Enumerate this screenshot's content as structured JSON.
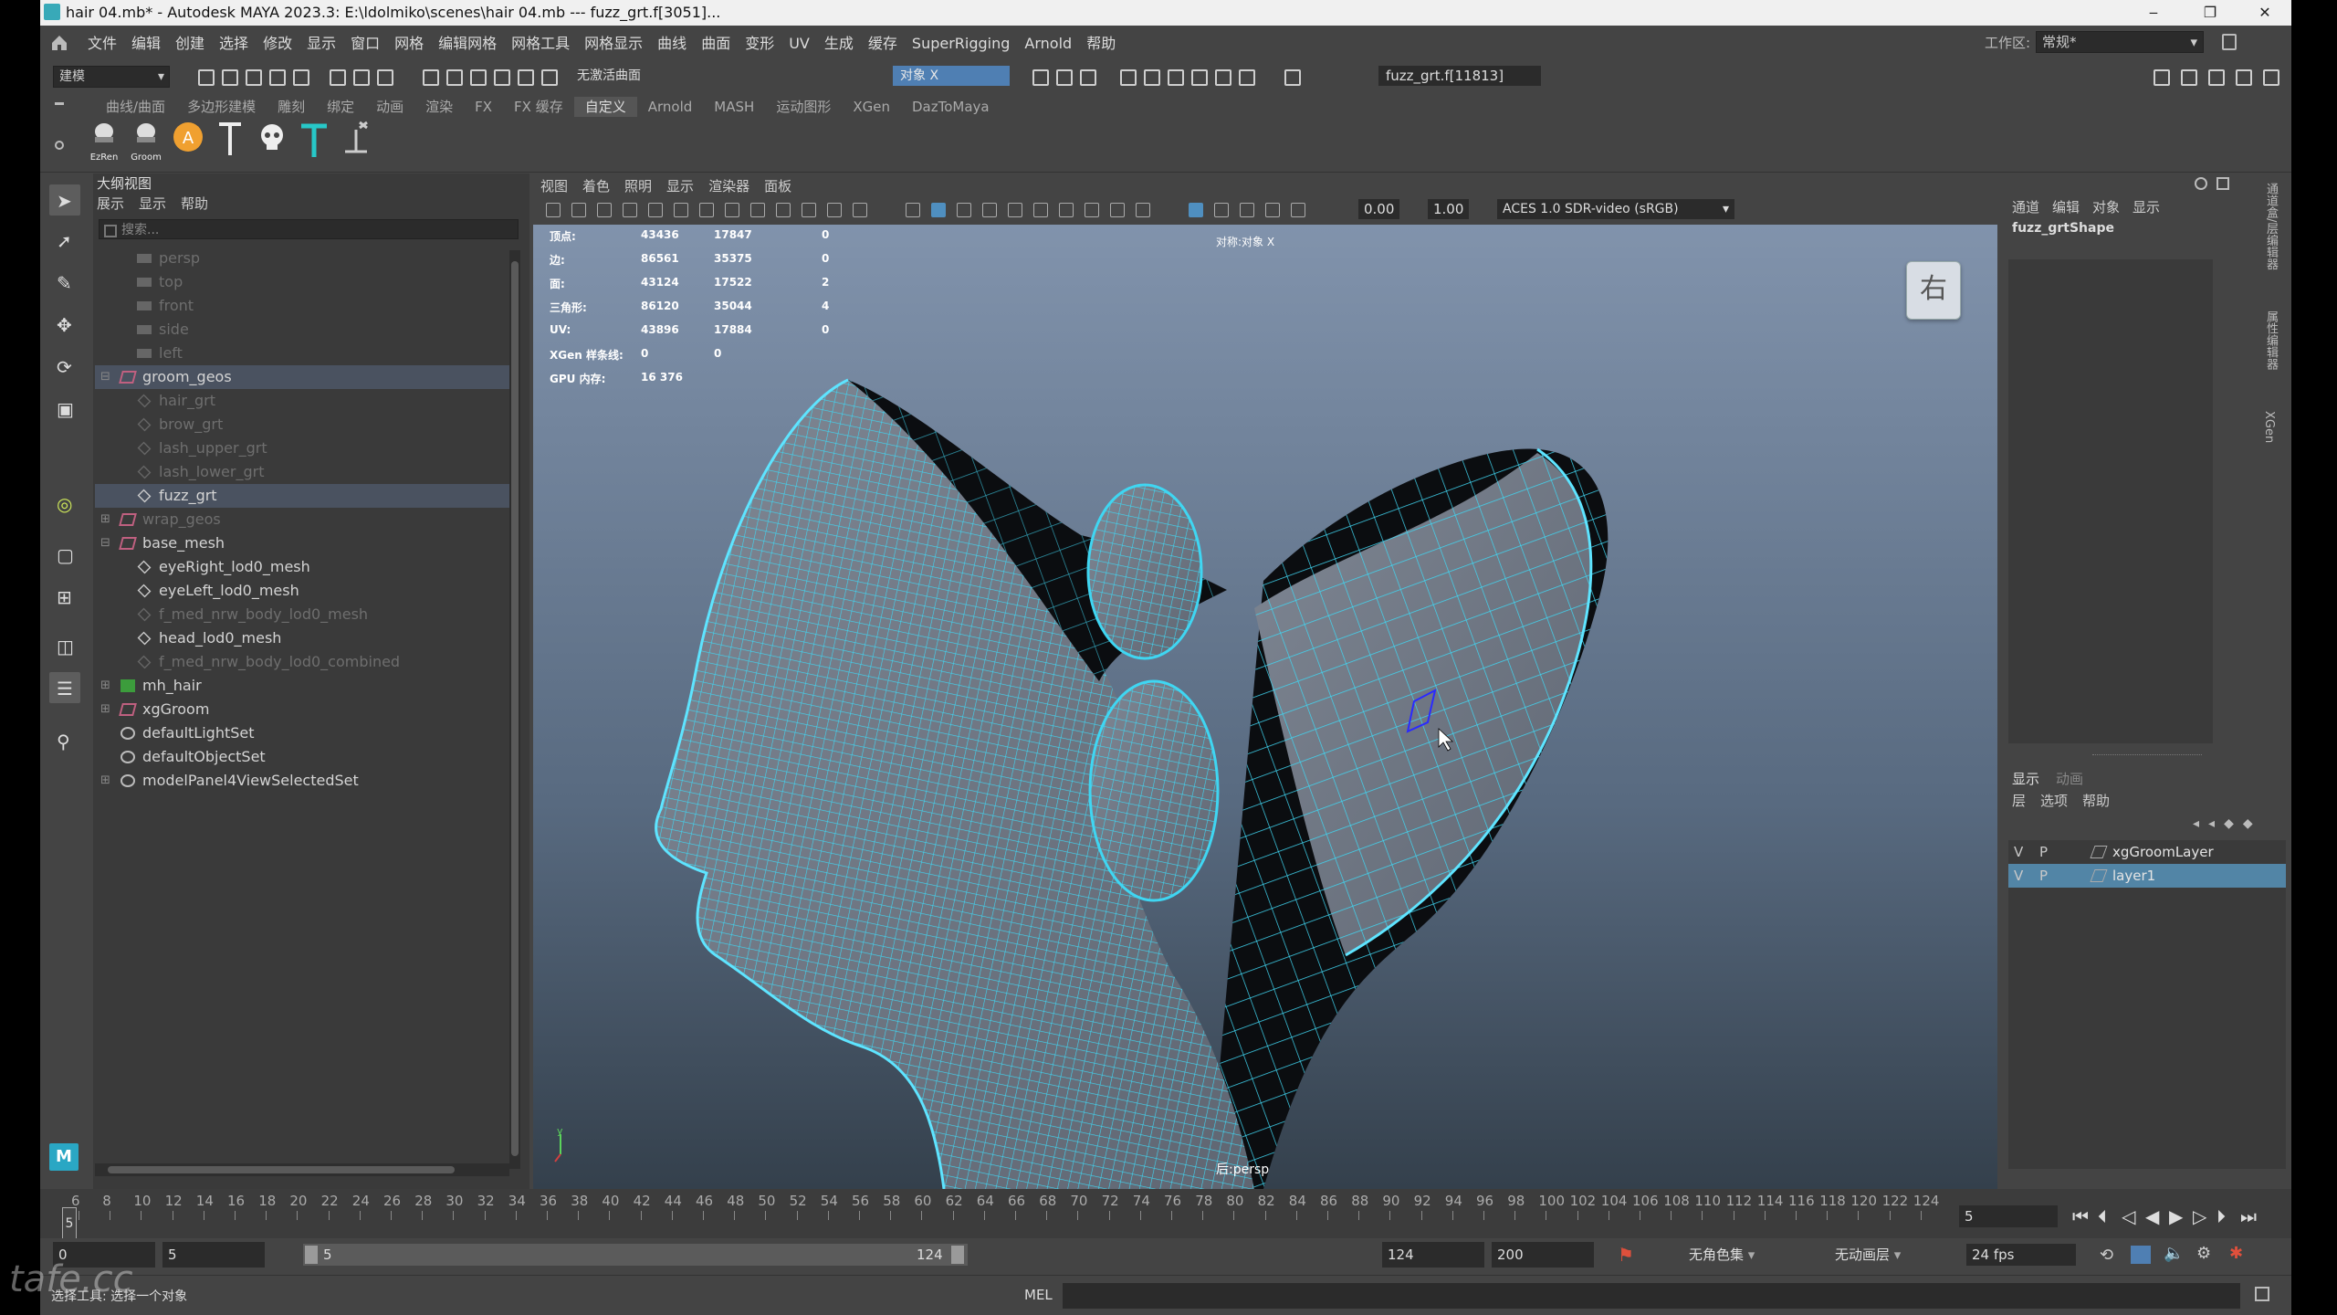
{
  "window": {
    "title": "hair 04.mb* - Autodesk MAYA 2023.3: E:\\ldolmiko\\scenes\\hair 04.mb  ---  fuzz_grt.f[3051]...",
    "minimize": "‒",
    "restore": "❐",
    "close": "✕"
  },
  "menubar": {
    "items": [
      "文件",
      "编辑",
      "创建",
      "选择",
      "修改",
      "显示",
      "窗口",
      "网格",
      "编辑网格",
      "网格工具",
      "网格显示",
      "曲线",
      "曲面",
      "变形",
      "UV",
      "生成",
      "缓存",
      "SuperRigging",
      "Arnold",
      "帮助"
    ],
    "workspace_label": "工作区:",
    "workspace_value": "常规*"
  },
  "statusline": {
    "mode": "建模",
    "live_surface": "无激活曲面",
    "symmetry": "对象 X",
    "selection_field": "fuzz_grt.f[11813]"
  },
  "shelf": {
    "tabs": [
      "曲线/曲面",
      "多边形建模",
      "雕刻",
      "绑定",
      "动画",
      "渲染",
      "FX",
      "FX 缓存",
      "自定义",
      "Arnold",
      "MASH",
      "运动图形",
      "XGen",
      "DazToMaya"
    ],
    "active_tab": "自定义",
    "buttons": [
      {
        "label": "EzRen"
      },
      {
        "label": "Groom"
      },
      {
        "label": "A"
      }
    ]
  },
  "outliner": {
    "title": "大纲视图",
    "menu": [
      "展示",
      "显示",
      "帮助"
    ],
    "search_placeholder": "搜索...",
    "rows": [
      {
        "label": "persp",
        "dim": true
      },
      {
        "label": "top",
        "dim": true
      },
      {
        "label": "front",
        "dim": true
      },
      {
        "label": "side",
        "dim": true
      },
      {
        "label": "left",
        "dim": true
      },
      {
        "label": "groom_geos",
        "dim": false
      },
      {
        "label": "hair_grt",
        "dim": true
      },
      {
        "label": "brow_grt",
        "dim": true
      },
      {
        "label": "lash_upper_grt",
        "dim": true
      },
      {
        "label": "lash_lower_grt",
        "dim": true
      },
      {
        "label": "fuzz_grt",
        "dim": false
      },
      {
        "label": "wrap_geos",
        "dim": true
      },
      {
        "label": "base_mesh",
        "dim": false
      },
      {
        "label": "eyeRight_lod0_mesh",
        "dim": false
      },
      {
        "label": "eyeLeft_lod0_mesh",
        "dim": false
      },
      {
        "label": "f_med_nrw_body_lod0_mesh",
        "dim": true
      },
      {
        "label": "head_lod0_mesh",
        "dim": false
      },
      {
        "label": "f_med_nrw_body_lod0_combined",
        "dim": true
      },
      {
        "label": "mh_hair",
        "dim": false
      },
      {
        "label": "xgGroom",
        "dim": false
      },
      {
        "label": "defaultLightSet",
        "dim": false
      },
      {
        "label": "defaultObjectSet",
        "dim": false
      },
      {
        "label": "modelPanel4ViewSelectedSet",
        "dim": false
      }
    ]
  },
  "viewport": {
    "menu": [
      "视图",
      "着色",
      "照明",
      "显示",
      "渲染器",
      "面板"
    ],
    "exposure": "0.00",
    "gamma": "1.00",
    "color_space": "ACES 1.0 SDR-video (sRGB)",
    "symmetry_hud": "对称:对象 X",
    "view_cube": "右",
    "camera_label": "后:persp",
    "hud": [
      {
        "label": "顶点:",
        "c1": "43436",
        "c2": "17847",
        "c3": "0"
      },
      {
        "label": "边:",
        "c1": "86561",
        "c2": "35375",
        "c3": "0"
      },
      {
        "label": "面:",
        "c1": "43124",
        "c2": "17522",
        "c3": "2"
      },
      {
        "label": "三角形:",
        "c1": "86120",
        "c2": "35044",
        "c3": "4"
      },
      {
        "label": "UV:",
        "c1": "43896",
        "c2": "17884",
        "c3": "0"
      },
      {
        "label": "XGen 样条线:",
        "c1": "0",
        "c2": "0",
        "c3": ""
      },
      {
        "label": "GPU 内存:",
        "c1": "16 376",
        "c2": "",
        "c3": ""
      }
    ]
  },
  "channel_box": {
    "menu": [
      "通道",
      "编辑",
      "对象",
      "显示"
    ],
    "object_name": "fuzz_grtShape",
    "side_tabs": [
      "通道盒/层编辑器",
      "属性编辑器",
      "XGen"
    ]
  },
  "layers": {
    "tabs": [
      "显示",
      "动画"
    ],
    "menu": [
      "层",
      "选项",
      "帮助"
    ],
    "rows": [
      {
        "v": "V",
        "p": "P",
        "name": "xgGroomLayer",
        "selected": false
      },
      {
        "v": "V",
        "p": "P",
        "name": "layer1",
        "selected": true
      }
    ]
  },
  "timeline": {
    "ticks": [
      "6",
      "8",
      "10",
      "12",
      "14",
      "16",
      "18",
      "20",
      "22",
      "24",
      "26",
      "28",
      "30",
      "32",
      "34",
      "36",
      "38",
      "40",
      "42",
      "44",
      "46",
      "48",
      "50",
      "52",
      "54",
      "56",
      "58",
      "60",
      "62",
      "64",
      "66",
      "68",
      "70",
      "72",
      "74",
      "76",
      "78",
      "80",
      "82",
      "84",
      "86",
      "88",
      "90",
      "92",
      "94",
      "96",
      "98",
      "100",
      "102",
      "104",
      "106",
      "108",
      "110",
      "112",
      "114",
      "116",
      "118",
      "120",
      "122",
      "124"
    ],
    "current_frame": "5",
    "current_frame_field": "5"
  },
  "range": {
    "start": "0",
    "playback_start": "5",
    "slider_start": "5",
    "slider_end": "124",
    "playback_end": "124",
    "end": "200",
    "character_set": "无角色集",
    "anim_layer": "无动画层",
    "fps": "24 fps"
  },
  "commandline": {
    "help": "选择工具: 选择一个对象",
    "mel": "MEL"
  },
  "watermark": "tafe.cc",
  "colors": {
    "wireframe": "#3fd6f2",
    "viewport_top": "#8193ac",
    "viewport_bottom": "#34404c",
    "selection": "#5285a6"
  }
}
